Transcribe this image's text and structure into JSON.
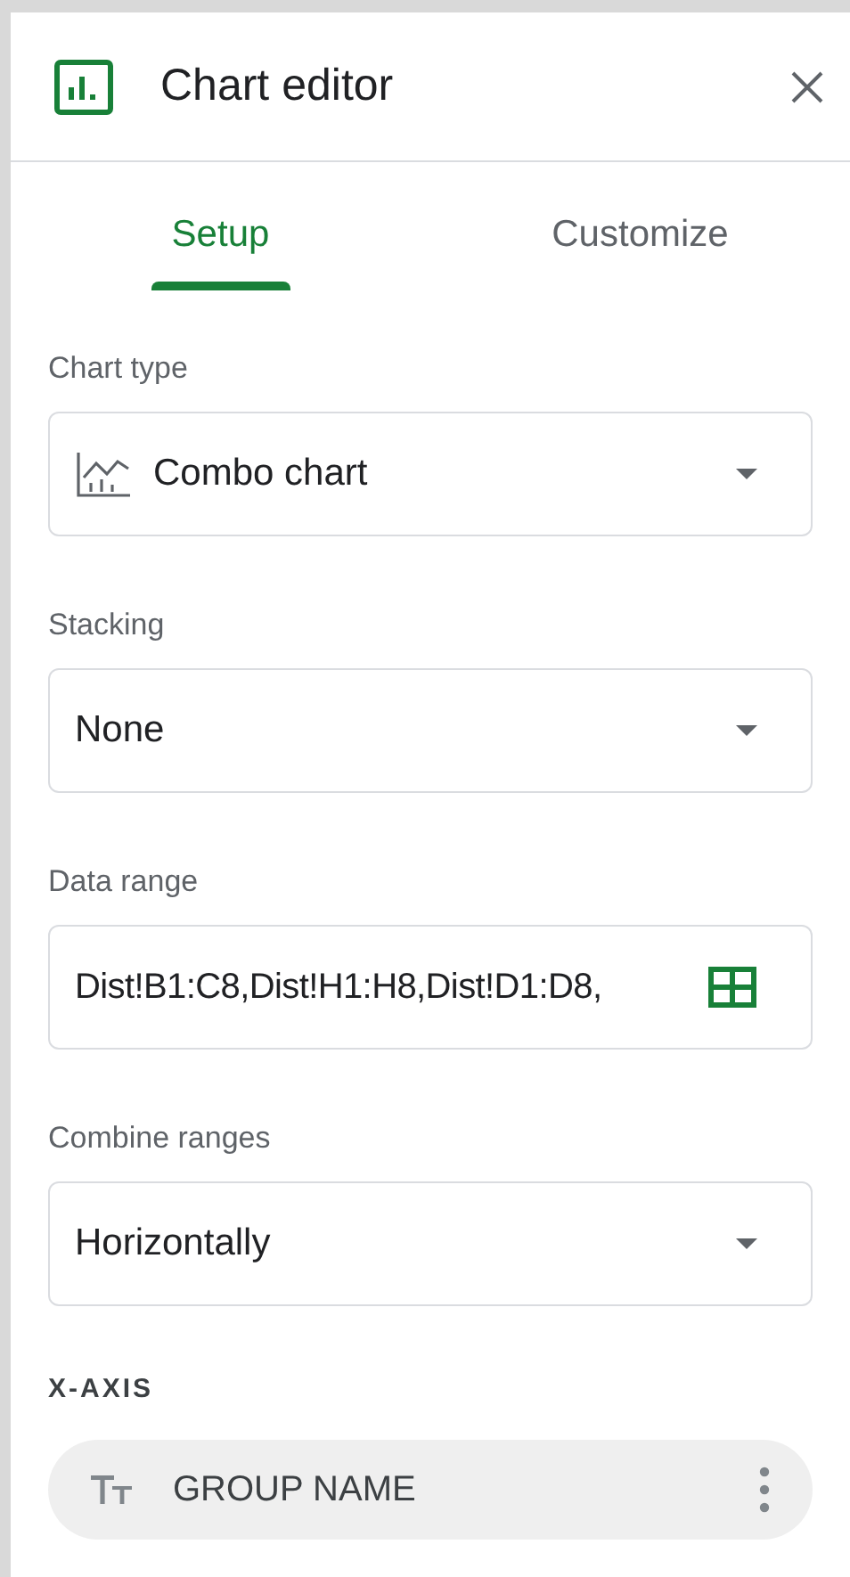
{
  "header": {
    "title": "Chart editor"
  },
  "tabs": [
    {
      "label": "Setup",
      "selected": true
    },
    {
      "label": "Customize",
      "selected": false
    }
  ],
  "fields": [
    {
      "kind": "select",
      "label": "Chart type",
      "value": "Combo chart"
    },
    {
      "kind": "select",
      "label": "Stacking",
      "value": "None"
    },
    {
      "kind": "range",
      "label": "Data range",
      "value": "Dist!B1:C8,Dist!H1:H8,Dist!D1:D8,"
    },
    {
      "kind": "select",
      "label": "Combine ranges",
      "value": "Horizontally"
    }
  ],
  "x_axis": {
    "heading": "X-AXIS",
    "chips": [
      "GROUP NAME"
    ]
  }
}
